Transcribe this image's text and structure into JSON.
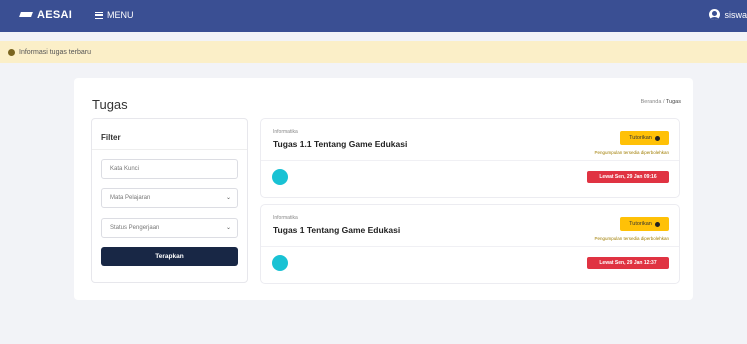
{
  "header": {
    "brand": "AESAI",
    "menu_label": "MENU",
    "user_name": "siswa"
  },
  "notice": {
    "text": "Informasi tugas terbaru"
  },
  "page": {
    "title": "Tugas",
    "breadcrumb": [
      "Beranda",
      "Tugas"
    ],
    "breadcrumb_sep": "/"
  },
  "filter": {
    "title": "Filter",
    "keyword_placeholder": "Kata Kunci",
    "subject_selected": "Mata Pelajaran",
    "status_selected": "Status Pengerjaan",
    "apply_label": "Terapkan"
  },
  "tasks": [
    {
      "category": "Informatika",
      "title": "Tugas 1.1 Tentang Game Edukasi",
      "status_label": "Tutorikan",
      "status_note": "Pengumpulan tersedia diperbolehkan",
      "due": "Lewat Sen, 29 Jan 09:16"
    },
    {
      "category": "Informatika",
      "title": "Tugas 1 Tentang Game Edukasi",
      "status_label": "Tutorikan",
      "status_note": "Pengumpulan tersedia diperbolehkan",
      "due": "Lewat Sen, 29 Jan 12:37"
    }
  ],
  "colors": {
    "navbar": "#3a4f93",
    "notice_bg": "#fbefc8",
    "status_button": "#ffc107",
    "due_badge": "#e03342",
    "apply_button": "#182745",
    "avatar_circle": "#19c2d4"
  },
  "icons": {
    "brand": "graduation-cap-icon",
    "menu": "hamburger-icon",
    "user": "user-circle-icon",
    "notice": "info-dot-icon",
    "select": "chevron-down-icon"
  }
}
